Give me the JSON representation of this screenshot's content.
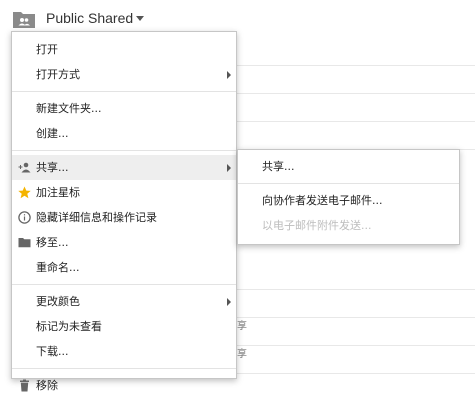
{
  "header": {
    "folder_icon": "shared-folder-icon",
    "title": "Public Shared",
    "caret_icon": "caret-down-icon"
  },
  "background": {
    "row_texts": [
      "享",
      "享"
    ]
  },
  "menu": {
    "items": [
      {
        "label": "打开"
      },
      {
        "label": "打开方式",
        "has_submenu": true
      },
      {
        "label": "新建文件夹..."
      },
      {
        "label": "创建..."
      },
      {
        "label": "共享...",
        "has_submenu": true,
        "icon": "add-person-icon"
      },
      {
        "label": "加注星标",
        "icon": "star-icon"
      },
      {
        "label": "隐藏详细信息和操作记录",
        "icon": "info-icon"
      },
      {
        "label": "移至...",
        "icon": "folder-icon"
      },
      {
        "label": "重命名..."
      },
      {
        "label": "更改颜色",
        "has_submenu": true
      },
      {
        "label": "标记为未查看"
      },
      {
        "label": "下载..."
      },
      {
        "label": "移除",
        "icon": "trash-icon"
      }
    ]
  },
  "submenu": {
    "items": [
      {
        "label": "共享..."
      },
      {
        "label": "向协作者发送电子邮件..."
      },
      {
        "label": "以电子邮件附件发送...",
        "disabled": true
      }
    ]
  },
  "colors": {
    "active_bg": "#eeeeee",
    "star": "#f4b400",
    "icon_gray": "#666666",
    "disabled_text": "#bdbdbd"
  }
}
